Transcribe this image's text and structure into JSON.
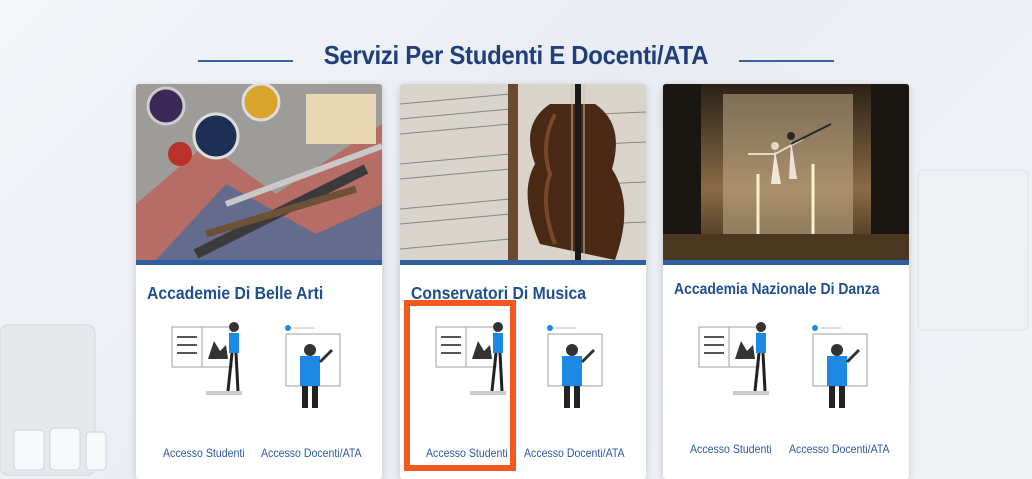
{
  "section_title": "Servizi Per Studenti E Docenti/ATA",
  "cards": [
    {
      "title": "Accademie Di Belle Arti",
      "students_link": "Accesso Studenti",
      "staff_link": "Accesso Docenti/ATA"
    },
    {
      "title": "Conservatori Di Musica",
      "students_link": "Accesso Studenti",
      "staff_link": "Accesso Docenti/ATA"
    },
    {
      "title": "Accademia Nazionale Di Danza",
      "students_link": "Accesso Studenti",
      "staff_link": "Accesso Docenti/ATA"
    }
  ],
  "highlight_color": "#f15a1e",
  "accent_color": "#2f5ea1"
}
